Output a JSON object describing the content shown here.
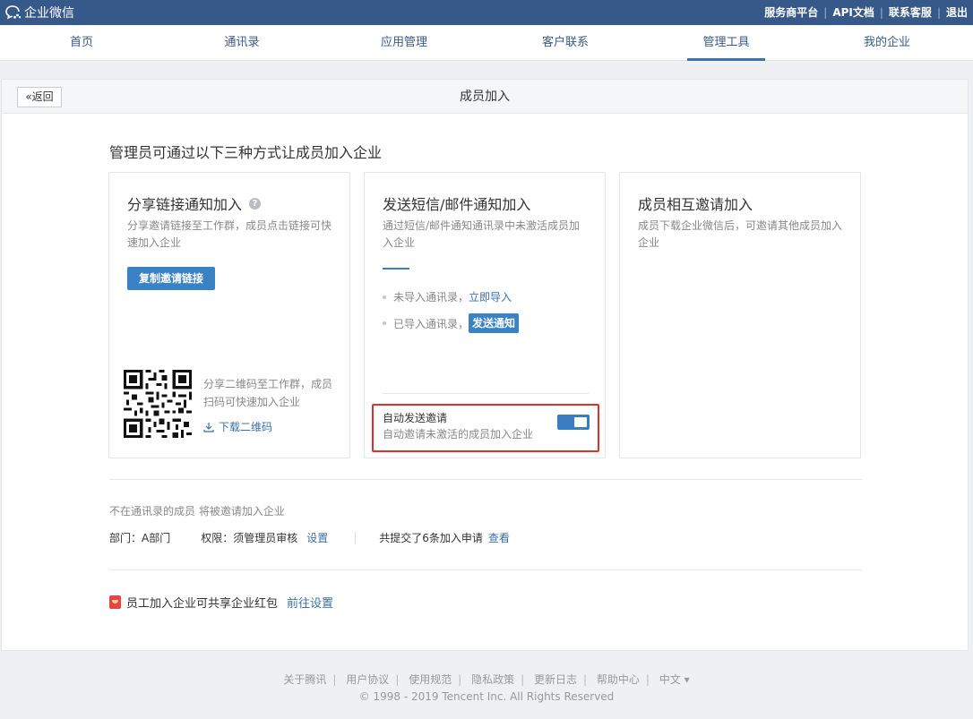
{
  "topbar": {
    "logo_text": "企业微信",
    "links": [
      "服务商平台",
      "API文档",
      "联系客服",
      "退出"
    ]
  },
  "nav": {
    "items": [
      "首页",
      "通讯录",
      "应用管理",
      "客户联系",
      "管理工具",
      "我的企业"
    ],
    "active": "管理工具"
  },
  "panel": {
    "back_label": "返回",
    "title": "成员加入",
    "intro": "管理员可通过以下三种方式让成员加入企业"
  },
  "cards": {
    "share": {
      "title": "分享链接通知加入",
      "desc": "分享邀请链接至工作群，成员点击链接可快速加入企业",
      "copy_button": "复制邀请链接",
      "qr_text": "分享二维码至工作群，成员扫码可快速加入企业",
      "download_label": "下载二维码"
    },
    "sms": {
      "title": "发送短信/邮件通知加入",
      "desc": "通过短信/邮件通知通讯录中未激活成员加入企业",
      "row1_text": "未导入通讯录，",
      "row1_link": "立即导入",
      "row2_text": "已导入通讯录，",
      "row2_button": "发送通知",
      "auto_title": "自动发送邀请",
      "auto_desc": "自动邀请未激活的成员加入企业",
      "auto_enabled": true
    },
    "mutual": {
      "title": "成员相互邀请加入",
      "desc": "成员下载企业微信后，可邀请其他成员加入企业"
    }
  },
  "info": {
    "not_in_contacts": "不在通讯录的成员 将被邀请加入企业",
    "department": "部门：A部门",
    "permission": "权限：须管理员审核",
    "settings_link": "设置",
    "applications": "共提交了6条加入申请",
    "view_link": "查看",
    "redpacket_text": "员工加入企业可共享企业红包",
    "redpacket_link": "前往设置"
  },
  "footer": {
    "links": [
      "关于腾讯",
      "用户协议",
      "使用规范",
      "隐私政策",
      "更新日志",
      "帮助中心",
      "中文 ▾"
    ],
    "copyright": "© 1998 - 2019 Tencent Inc. All Rights Reserved"
  },
  "colors": {
    "topbar": "#37598a",
    "accent": "#3b82c4",
    "highlight_border": "#e0302c"
  }
}
